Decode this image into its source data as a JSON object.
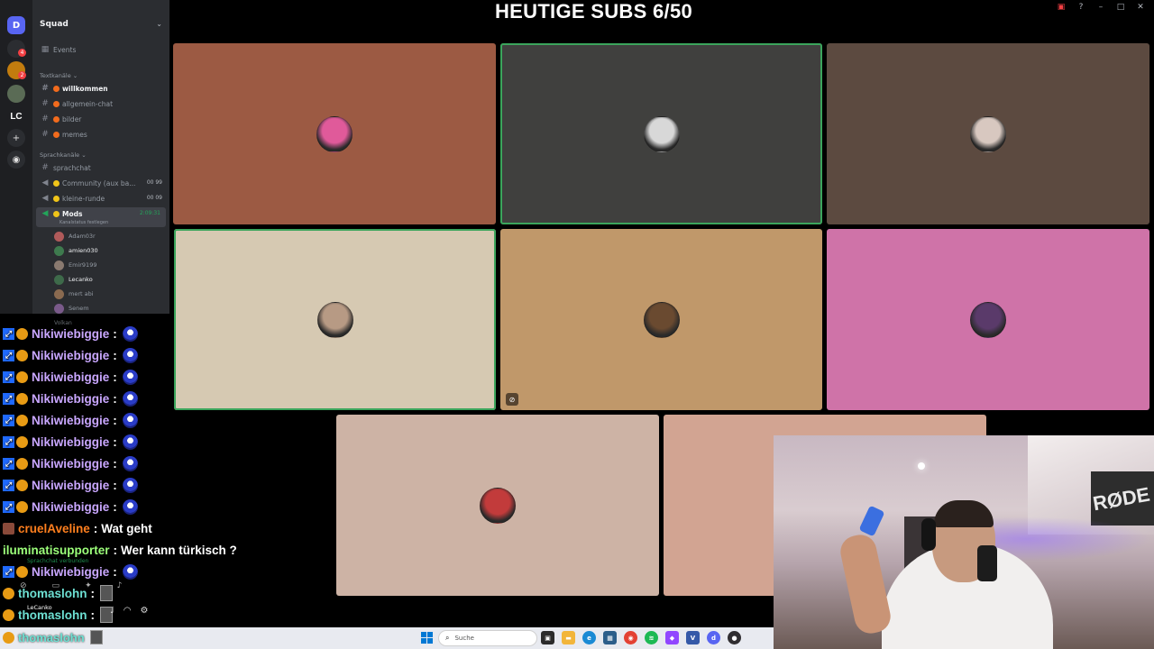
{
  "stream": {
    "title": "HEUTIGE SUBS 6/50"
  },
  "server": {
    "name": "Squad",
    "rail_label": "LC",
    "badges": [
      "4",
      "2"
    ]
  },
  "sidebar": {
    "events_label": "Events",
    "text_category": "Textkanäle",
    "text_channels": [
      "willkommen",
      "allgemein-chat",
      "bilder",
      "memes"
    ],
    "voice_category": "Sprachkanäle",
    "voice_channels": [
      {
        "label": "sprachchat",
        "counts": ""
      },
      {
        "label": "Community (aux ba...",
        "counts": "00  99"
      },
      {
        "label": "kleine-runde",
        "counts": "00  09"
      }
    ],
    "active_channel": {
      "label": "Mods",
      "time": "2:09:31",
      "status": "Kanalstatus festlegen"
    },
    "members": [
      "Adam03r",
      "amien030",
      "Emir9199",
      "Lecanko",
      "mert abi",
      "Senem",
      "Volkan"
    ]
  },
  "chat": {
    "messages": [
      {
        "user": "Nikiwiebiggie",
        "text": "",
        "color": "purple",
        "emote": true
      },
      {
        "user": "Nikiwiebiggie",
        "text": "",
        "color": "purple",
        "emote": true
      },
      {
        "user": "Nikiwiebiggie",
        "text": "",
        "color": "purple",
        "emote": true
      },
      {
        "user": "Nikiwiebiggie",
        "text": "",
        "color": "purple",
        "emote": true
      },
      {
        "user": "Nikiwiebiggie",
        "text": "",
        "color": "purple",
        "emote": true
      },
      {
        "user": "Nikiwiebiggie",
        "text": "",
        "color": "purple",
        "emote": true
      },
      {
        "user": "Nikiwiebiggie",
        "text": "",
        "color": "purple",
        "emote": true
      },
      {
        "user": "Nikiwiebiggie",
        "text": "",
        "color": "purple",
        "emote": true
      },
      {
        "user": "Nikiwiebiggie",
        "text": "",
        "color": "purple",
        "emote": true
      },
      {
        "user": "cruelAveline",
        "text": "Wat geht",
        "color": "orange",
        "emote": false
      },
      {
        "user": "iluminatisupporter",
        "text": "Wer kann türkisch ?",
        "color": "green",
        "emote": false
      },
      {
        "user": "Nikiwiebiggie",
        "text": "",
        "color": "purple",
        "emote": true
      },
      {
        "user": "thomaslohn",
        "text": "",
        "color": "teal",
        "emote": false
      },
      {
        "user": "thomaslohn",
        "text": "",
        "color": "teal",
        "emote": false
      }
    ],
    "separator": ":"
  },
  "user_panel": {
    "voice_status": "Sprachchat verbunden",
    "username": "LeCanko"
  },
  "voice_tiles": [
    {
      "bg": "#9c5a43",
      "speaking": false,
      "avatar": "#e05a9a"
    },
    {
      "bg": "#40403e",
      "speaking": true,
      "avatar": "#d8d8d8"
    },
    {
      "bg": "#5c4a40",
      "speaking": false,
      "avatar": "#d8c8c0"
    },
    {
      "bg": "#d6c9b2",
      "speaking": true,
      "avatar": "#b79a84"
    },
    {
      "bg": "#c0986a",
      "speaking": false,
      "avatar": "#6a4a30",
      "muted": true
    },
    {
      "bg": "#cf73a8",
      "speaking": false,
      "avatar": "#5a3a6a"
    },
    {
      "bg": "#cdb3a5",
      "speaking": false,
      "avatar": "#c23b3b"
    },
    {
      "bg": "#d2a492",
      "speaking": false,
      "avatar": "#b08070"
    }
  ],
  "taskbar": {
    "search_placeholder": "Suche",
    "user": "thomaslohn"
  },
  "webcam": {
    "wall_text": "RØDE"
  }
}
